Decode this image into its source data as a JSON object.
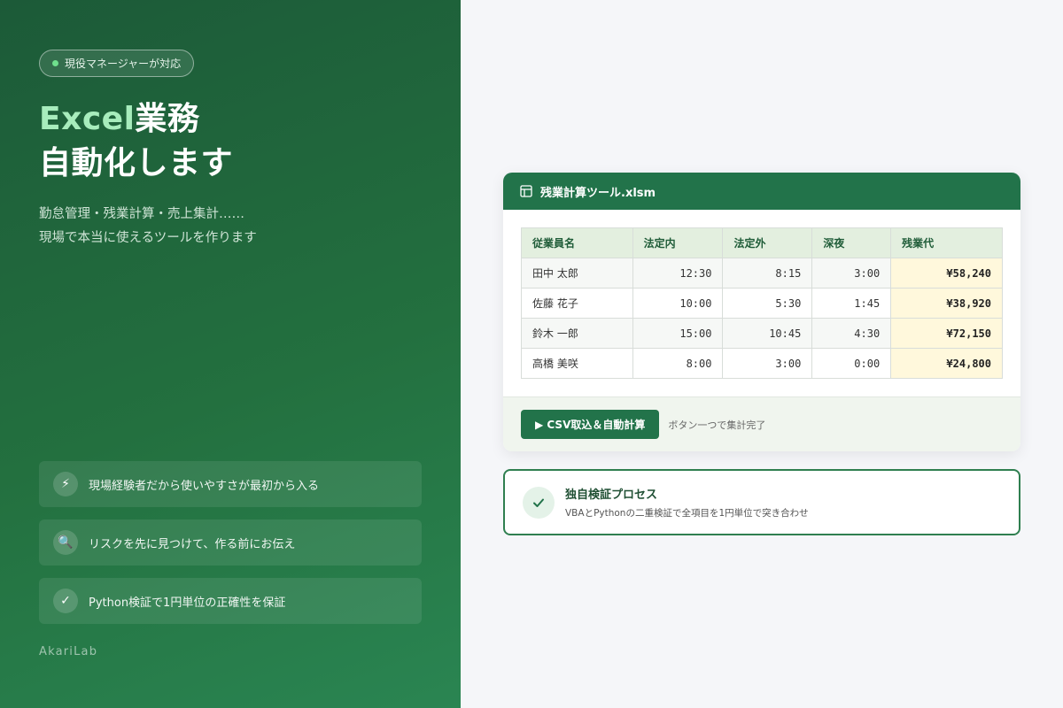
{
  "hero": {
    "badge": "現役マネージャーが対応",
    "headline_accent": "Excel",
    "headline_rest": "業務",
    "headline_line2": "自動化します",
    "sub_line1": "勤怠管理・残業計算・売上集計……",
    "sub_line2": "現場で本当に使えるツールを作ります"
  },
  "features": [
    {
      "icon": "lightning-icon",
      "glyph": "⚡",
      "text": "現場経験者だから使いやすさが最初から入る"
    },
    {
      "icon": "magnifier-icon",
      "glyph": "🔍",
      "text": "リスクを先に見つけて、作る前にお伝え"
    },
    {
      "icon": "checkmark-icon",
      "glyph": "✓",
      "text": "Python検証で1円単位の正確性を保証"
    }
  ],
  "brand": "AkariLab",
  "sheet": {
    "filename": "残業計算ツール.xlsm",
    "columns": [
      "従業員名",
      "法定内",
      "法定外",
      "深夜",
      "残業代"
    ],
    "rows": [
      [
        "田中 太郎",
        "12:30",
        "8:15",
        "3:00",
        "¥58,240"
      ],
      [
        "佐藤 花子",
        "10:00",
        "5:30",
        "1:45",
        "¥38,920"
      ],
      [
        "鈴木 一郎",
        "15:00",
        "10:45",
        "4:30",
        "¥72,150"
      ],
      [
        "高橋 美咲",
        "8:00",
        "3:00",
        "0:00",
        "¥24,800"
      ]
    ],
    "button_label": "▶ CSV取込＆自動計算",
    "footer_note": "ボタン一つで集計完了"
  },
  "verify": {
    "title": "独自検証プロセス",
    "description": "VBAとPythonの二重検証で全項目を1円単位で突き合わせ"
  },
  "colors": {
    "primary_green": "#22734a",
    "accent_light_green": "#a7ecbc",
    "highlight_yellow": "#fff8dc"
  }
}
